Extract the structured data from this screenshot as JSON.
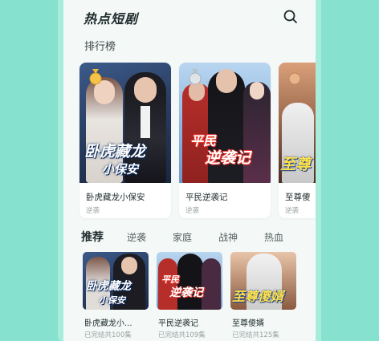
{
  "header": {
    "title": "热点短剧"
  },
  "ranking": {
    "section_title": "排行榜",
    "cards": [
      {
        "name": "卧虎藏龙小保安",
        "tag": "逆袭",
        "poster_line1": "卧虎藏龙",
        "poster_line2": "小保安",
        "medal": "gold"
      },
      {
        "name": "平民逆袭记",
        "tag": "逆袭",
        "poster_line1": "平民",
        "poster_line2": "逆袭记",
        "medal": "silver"
      },
      {
        "name": "至尊傻",
        "tag": "逆袭",
        "poster_line1": "至尊",
        "poster_line2": "",
        "medal": "bronze"
      }
    ]
  },
  "tabs": [
    {
      "label": "推荐",
      "active": true
    },
    {
      "label": "逆袭"
    },
    {
      "label": "家庭"
    },
    {
      "label": "战神"
    },
    {
      "label": "热血"
    }
  ],
  "recommend": [
    {
      "name": "卧虎藏龙小...",
      "meta": "已完结共100集",
      "poster_line1": "卧虎藏龙",
      "poster_line2": "小保安"
    },
    {
      "name": "平民逆袭记",
      "meta": "已完结共109集",
      "poster_line1": "平民",
      "poster_line2": "逆袭记"
    },
    {
      "name": "至尊傻婿",
      "meta": "已完结共125集",
      "poster_line1": "至尊傻婿",
      "poster_line2": ""
    }
  ],
  "colors": {
    "background": "#86e2ce",
    "poster_title_stroke": "#0b2a5c",
    "poster_red_title": "#e8332a"
  },
  "icons": {
    "search": "search-icon",
    "medal_gold": "gold-medal-icon",
    "medal_silver": "silver-medal-icon",
    "medal_bronze": "bronze-medal-icon"
  }
}
